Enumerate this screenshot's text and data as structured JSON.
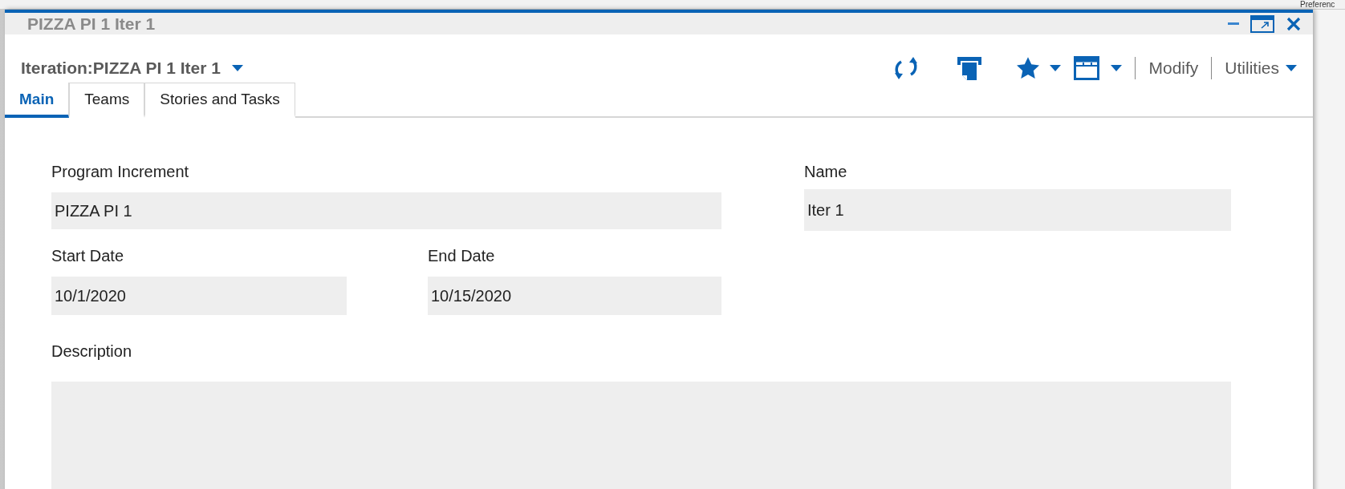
{
  "background": {
    "menu_item": "Preferenc"
  },
  "window": {
    "title": "PIZZA PI 1 Iter 1"
  },
  "header": {
    "title": "Iteration:PIZZA PI 1 Iter 1",
    "actions": [
      "Modify",
      "Utilities"
    ]
  },
  "tabs": [
    {
      "label": "Main",
      "selected": true
    },
    {
      "label": "Teams",
      "selected": false
    },
    {
      "label": "Stories and Tasks",
      "selected": false
    }
  ],
  "fields": {
    "program_increment": {
      "label": "Program Increment",
      "value": "PIZZA PI 1"
    },
    "name": {
      "label": "Name",
      "value": "Iter 1"
    },
    "start_date": {
      "label": "Start Date",
      "value": "10/1/2020"
    },
    "end_date": {
      "label": "End Date",
      "value": "10/15/2020"
    },
    "description": {
      "label": "Description"
    }
  }
}
